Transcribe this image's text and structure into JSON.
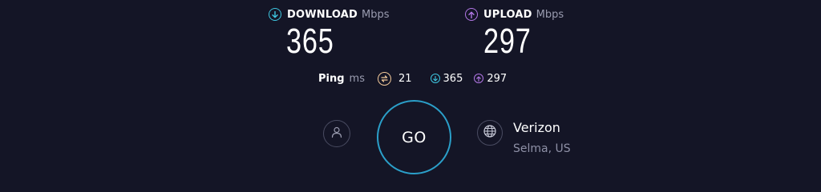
{
  "download": {
    "label": "DOWNLOAD",
    "unit": "Mbps",
    "value": "365",
    "icon": "arrow-down-circle-icon",
    "color": "#3ec6e0"
  },
  "upload": {
    "label": "UPLOAD",
    "unit": "Mbps",
    "value": "297",
    "icon": "arrow-up-circle-icon",
    "color": "#b277e6"
  },
  "ping": {
    "label": "Ping",
    "unit": "ms",
    "value": "21",
    "download_value": "365",
    "upload_value": "297",
    "icon": "jitter-icon",
    "color": "#f2c99a"
  },
  "controls": {
    "go_label": "GO",
    "go_color": "#2b9fc9",
    "profile_icon": "user-icon",
    "server_icon": "globe-icon"
  },
  "server": {
    "isp": "Verizon",
    "location": "Selma, US"
  }
}
